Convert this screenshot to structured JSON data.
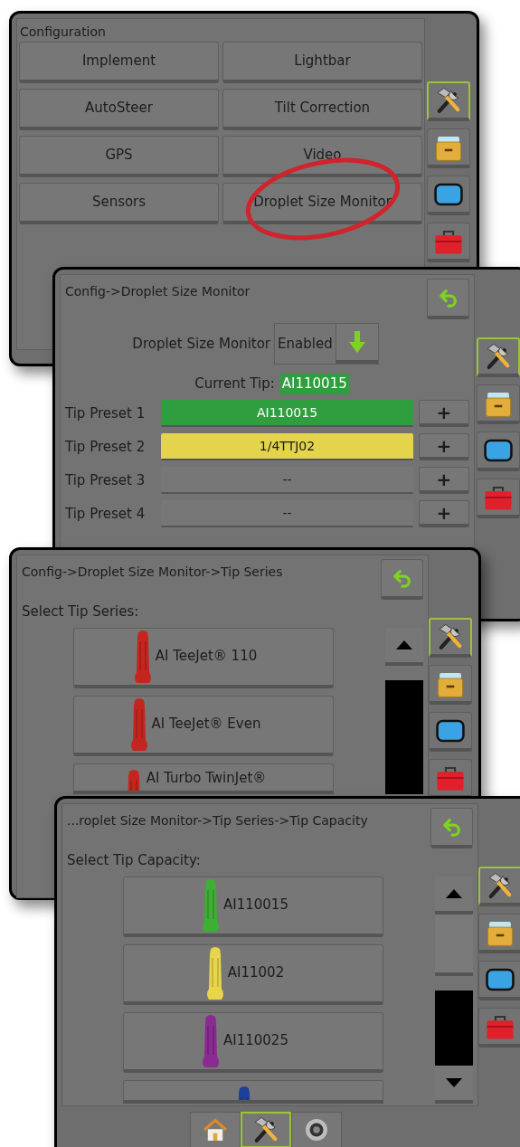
{
  "screens": [
    {
      "kind": "menu",
      "title": "Configuration",
      "buttons": [
        {
          "label": "Implement",
          "circled": false
        },
        {
          "label": "Lightbar",
          "circled": false
        },
        {
          "label": "AutoSteer",
          "circled": false
        },
        {
          "label": "Tilt Correction",
          "circled": false
        },
        {
          "label": "GPS",
          "circled": false
        },
        {
          "label": "Video",
          "circled": false
        },
        {
          "label": "Sensors",
          "circled": false
        },
        {
          "label": "Droplet Size Monitor",
          "circled": true
        }
      ],
      "sidebar": [
        {
          "kind": "tools",
          "selected": true
        },
        {
          "kind": "cabinet",
          "selected": false
        },
        {
          "kind": "monitor",
          "selected": false
        },
        {
          "kind": "toolbox",
          "selected": false
        }
      ]
    },
    {
      "kind": "droplet",
      "title": "Config->Droplet Size Monitor",
      "setting": {
        "label": "Droplet Size Monitor",
        "value": "Enabled"
      },
      "current_tip": {
        "label": "Current Tip:",
        "value": "AI110015"
      },
      "presets": [
        {
          "label": "Tip Preset 1",
          "value": "AI110015",
          "add": "+",
          "color": "#2e9e3e"
        },
        {
          "label": "Tip Preset 2",
          "value": "1/4TTJ02",
          "add": "+",
          "color": "#e3d44c"
        },
        {
          "label": "Tip Preset 3",
          "value": "--",
          "add": "+"
        },
        {
          "label": "Tip Preset 4",
          "value": "--",
          "add": "+"
        }
      ],
      "sidebar": [
        {
          "kind": "tools",
          "selected": true
        },
        {
          "kind": "cabinet",
          "selected": false
        },
        {
          "kind": "monitor",
          "selected": false
        },
        {
          "kind": "toolbox",
          "selected": false
        }
      ]
    },
    {
      "kind": "list",
      "title": "Config->Droplet Size Monitor->Tip Series",
      "prompt": "Select Tip Series:",
      "items": [
        {
          "label": "AI TeeJet® 110",
          "color": "#c4261f"
        },
        {
          "label": "AI TeeJet® Even",
          "color": "#c4261f"
        },
        {
          "label": "AI Turbo TwinJet®",
          "color": "#c4261f"
        }
      ],
      "sidebar": [
        {
          "kind": "tools",
          "selected": true
        },
        {
          "kind": "cabinet",
          "selected": false
        },
        {
          "kind": "monitor",
          "selected": false
        },
        {
          "kind": "toolbox",
          "selected": false
        }
      ]
    },
    {
      "kind": "list",
      "title": "...roplet Size Monitor->Tip Series->Tip Capacity",
      "prompt": "Select Tip Capacity:",
      "items": [
        {
          "label": "AI110015",
          "color": "#3fae35"
        },
        {
          "label": "AI11002",
          "color": "#e8d54a"
        },
        {
          "label": "AI110025",
          "color": "#8a2a93"
        },
        {
          "color": "#1f3f9a"
        }
      ],
      "sidebar": [
        {
          "kind": "tools",
          "selected": true
        },
        {
          "kind": "cabinet",
          "selected": false
        },
        {
          "kind": "monitor",
          "selected": false
        },
        {
          "kind": "toolbox",
          "selected": false
        }
      ],
      "bottom_tabs": [
        {
          "kind": "home",
          "selected": false
        },
        {
          "kind": "tools",
          "selected": true
        },
        {
          "kind": "camera",
          "selected": false
        }
      ]
    }
  ]
}
